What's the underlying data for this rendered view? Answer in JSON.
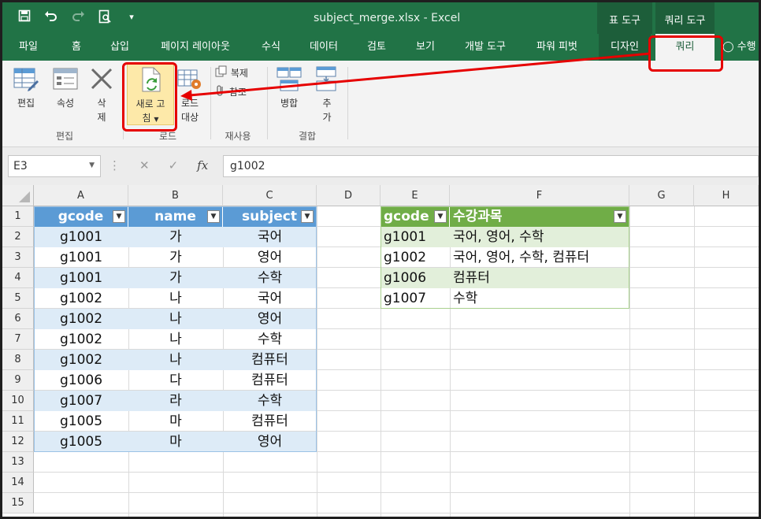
{
  "titlebar": {
    "title": "subject_merge.xlsx - Excel",
    "qat": [
      "save-icon",
      "undo-icon",
      "redo-icon",
      "print-preview-icon",
      "customize-icon"
    ]
  },
  "context_headers": {
    "table_tools": "표 도구",
    "query_tools": "쿼리 도구"
  },
  "tabs": [
    "파일",
    "홈",
    "삽입",
    "페이지 레이아웃",
    "수식",
    "데이터",
    "검토",
    "보기",
    "개발 도구",
    "파워 피벗",
    "디자인",
    "쿼리"
  ],
  "tell_me": "수행",
  "ribbon": {
    "edit": "편집",
    "properties": "속성",
    "delete_1": "삭",
    "delete_2": "제",
    "refresh_1": "새로 고",
    "refresh_2": "침",
    "load_to_1": "로드",
    "load_to_2": "대상",
    "duplicate": "복제",
    "reference": "참조",
    "merge": "병합",
    "append_1": "추",
    "append_2": "가",
    "groups": {
      "edit": "편집",
      "load": "로드",
      "reuse": "재사용",
      "combine": "결합"
    }
  },
  "formula_bar": {
    "name_box": "E3",
    "formula": "g1002"
  },
  "columns": [
    "A",
    "B",
    "C",
    "D",
    "E",
    "F",
    "G",
    "H"
  ],
  "rows": [
    "1",
    "2",
    "3",
    "4",
    "5",
    "6",
    "7",
    "8",
    "9",
    "10",
    "11",
    "12",
    "13",
    "14",
    "15"
  ],
  "table1": {
    "headers": [
      "gcode",
      "name",
      "subject"
    ],
    "rows": [
      [
        "g1001",
        "가",
        "국어"
      ],
      [
        "g1001",
        "가",
        "영어"
      ],
      [
        "g1001",
        "가",
        "수학"
      ],
      [
        "g1002",
        "나",
        "국어"
      ],
      [
        "g1002",
        "나",
        "영어"
      ],
      [
        "g1002",
        "나",
        "수학"
      ],
      [
        "g1002",
        "나",
        "컴퓨터"
      ],
      [
        "g1006",
        "다",
        "컴퓨터"
      ],
      [
        "g1007",
        "라",
        "수학"
      ],
      [
        "g1005",
        "마",
        "컴퓨터"
      ],
      [
        "g1005",
        "마",
        "영어"
      ]
    ]
  },
  "table2": {
    "headers": [
      "gcode",
      "수강과목"
    ],
    "rows": [
      [
        "g1001",
        "국어, 영어, 수학"
      ],
      [
        "g1002",
        "국어, 영어, 수학, 컴퓨터"
      ],
      [
        "g1006",
        "컴퓨터"
      ],
      [
        "g1007",
        "수학"
      ]
    ]
  },
  "colors": {
    "excel_green": "#217346",
    "table_blue": "#5b9bd5",
    "table_green": "#70ad47",
    "annotation_red": "#e60000"
  }
}
